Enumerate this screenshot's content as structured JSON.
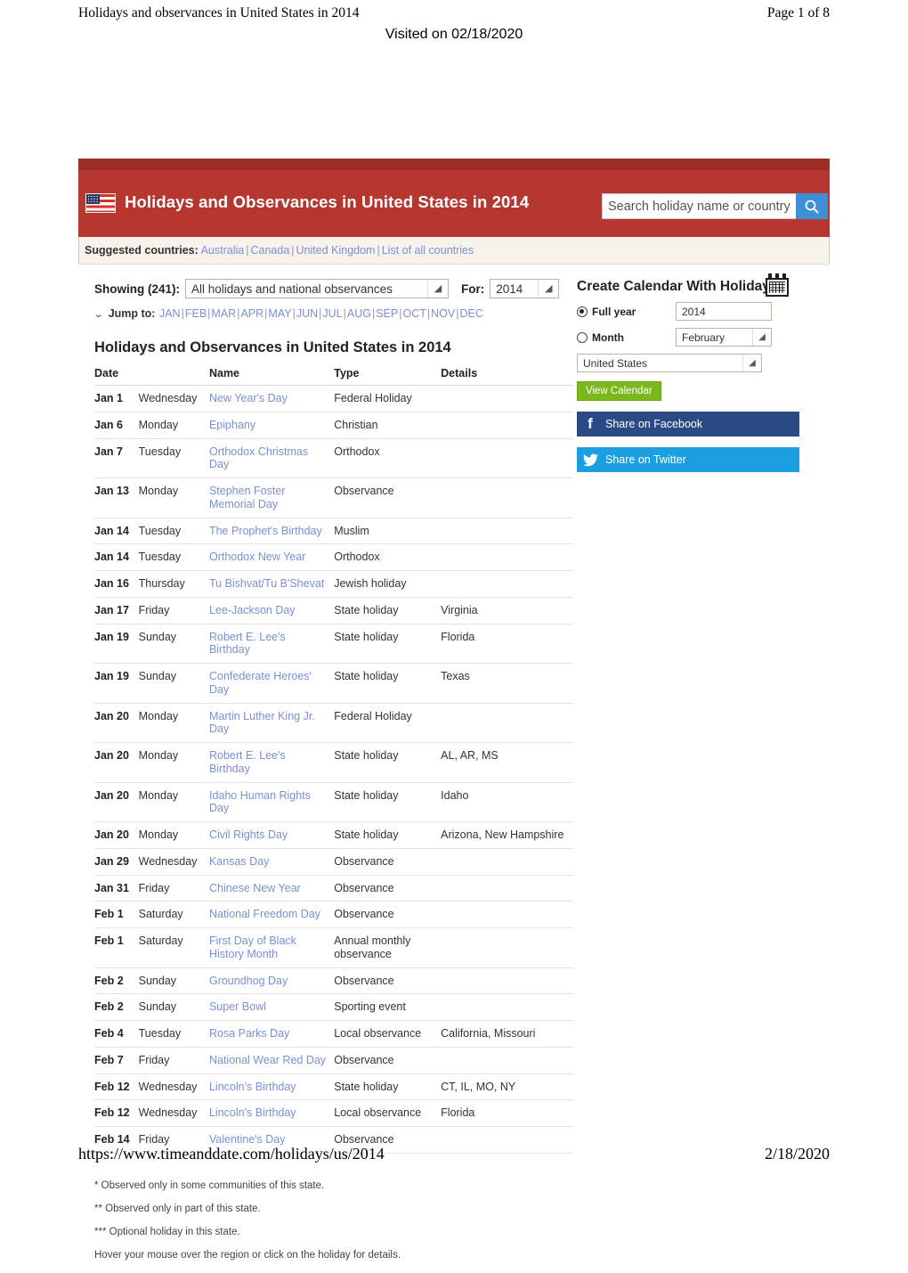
{
  "print": {
    "header_title": "Holidays and observances in United States in 2014",
    "page_indicator": "Page 1 of 8",
    "visited": "Visited on 02/18/2020",
    "footer_url": "https://www.timeanddate.com/holidays/us/2014",
    "footer_date": "2/18/2020"
  },
  "banner": {
    "title": "Holidays and Observances in United States in 2014",
    "flag_icon": "us-flag-icon",
    "search_placeholder": "Search holiday name or country",
    "search_value": "",
    "search_icon": "search-icon",
    "bg_color": "#b5372f"
  },
  "suggested": {
    "label": "Suggested countries:",
    "links": [
      "Australia",
      "Canada",
      "United Kingdom",
      "List of all countries"
    ]
  },
  "filters": {
    "showing_label": "Showing (241):",
    "showing_value": "All holidays and national observances",
    "for_label": "For:",
    "year_value": "2014",
    "jump_label": "Jump to:",
    "jump_months": [
      "JAN",
      "FEB",
      "MAR",
      "APR",
      "MAY",
      "JUN",
      "JUL",
      "AUG",
      "SEP",
      "OCT",
      "NOV",
      "DEC"
    ]
  },
  "main": {
    "section_title": "Holidays and Observances in United States in 2014",
    "columns": [
      "Date",
      "",
      "Name",
      "Type",
      "Details"
    ],
    "rows": [
      {
        "date": "Jan 1",
        "day": "Wednesday",
        "name": "New Year's Day",
        "type": "Federal Holiday",
        "details": ""
      },
      {
        "date": "Jan 6",
        "day": "Monday",
        "name": "Epiphany",
        "type": "Christian",
        "details": ""
      },
      {
        "date": "Jan 7",
        "day": "Tuesday",
        "name": "Orthodox Christmas Day",
        "type": "Orthodox",
        "details": ""
      },
      {
        "date": "Jan 13",
        "day": "Monday",
        "name": "Stephen Foster Memorial Day",
        "type": "Observance",
        "details": ""
      },
      {
        "date": "Jan 14",
        "day": "Tuesday",
        "name": "The Prophet's Birthday",
        "type": "Muslim",
        "details": ""
      },
      {
        "date": "Jan 14",
        "day": "Tuesday",
        "name": "Orthodox New Year",
        "type": "Orthodox",
        "details": ""
      },
      {
        "date": "Jan 16",
        "day": "Thursday",
        "name": "Tu Bishvat/Tu B'Shevat",
        "type": "Jewish holiday",
        "details": ""
      },
      {
        "date": "Jan 17",
        "day": "Friday",
        "name": "Lee-Jackson Day",
        "type": "State holiday",
        "details": "Virginia"
      },
      {
        "date": "Jan 19",
        "day": "Sunday",
        "name": "Robert E. Lee's Birthday",
        "type": "State holiday",
        "details": "Florida"
      },
      {
        "date": "Jan 19",
        "day": "Sunday",
        "name": "Confederate Heroes' Day",
        "type": "State holiday",
        "details": "Texas"
      },
      {
        "date": "Jan 20",
        "day": "Monday",
        "name": "Martin Luther King Jr. Day",
        "type": "Federal Holiday",
        "details": ""
      },
      {
        "date": "Jan 20",
        "day": "Monday",
        "name": "Robert E. Lee's Birthday",
        "type": "State holiday",
        "details": "AL, AR, MS"
      },
      {
        "date": "Jan 20",
        "day": "Monday",
        "name": "Idaho Human Rights Day",
        "type": "State holiday",
        "details": "Idaho"
      },
      {
        "date": "Jan 20",
        "day": "Monday",
        "name": "Civil Rights Day",
        "type": "State holiday",
        "details": "Arizona, New Hampshire"
      },
      {
        "date": "Jan 29",
        "day": "Wednesday",
        "name": "Kansas Day",
        "type": "Observance",
        "details": ""
      },
      {
        "date": "Jan 31",
        "day": "Friday",
        "name": "Chinese New Year",
        "type": "Observance",
        "details": ""
      },
      {
        "date": "Feb 1",
        "day": "Saturday",
        "name": "National Freedom Day",
        "type": "Observance",
        "details": ""
      },
      {
        "date": "Feb 1",
        "day": "Saturday",
        "name": "First Day of Black History Month",
        "type": "Annual monthly observance",
        "details": ""
      },
      {
        "date": "Feb 2",
        "day": "Sunday",
        "name": "Groundhog Day",
        "type": "Observance",
        "details": ""
      },
      {
        "date": "Feb 2",
        "day": "Sunday",
        "name": "Super Bowl",
        "type": "Sporting event",
        "details": ""
      },
      {
        "date": "Feb 4",
        "day": "Tuesday",
        "name": "Rosa Parks Day",
        "type": "Local observance",
        "details": "California, Missouri"
      },
      {
        "date": "Feb 7",
        "day": "Friday",
        "name": "National Wear Red Day",
        "type": "Observance",
        "details": ""
      },
      {
        "date": "Feb 12",
        "day": "Wednesday",
        "name": "Lincoln's Birthday",
        "type": "State holiday",
        "details": "CT, IL, MO, NY"
      },
      {
        "date": "Feb 12",
        "day": "Wednesday",
        "name": "Lincoln's Birthday",
        "type": "Local observance",
        "details": "Florida"
      },
      {
        "date": "Feb 14",
        "day": "Friday",
        "name": "Valentine's Day",
        "type": "Observance",
        "details": ""
      }
    ]
  },
  "footnotes": [
    "* Observed only in some communities of this state.",
    "** Observed only in part of this state.",
    "*** Optional holiday in this state.",
    "Hover your mouse over the region or click on the holiday for details."
  ],
  "sidebar": {
    "title": "Create Calendar With Holidays",
    "calendar_icon": "calendar-icon",
    "full_year_label": "Full year",
    "full_year_selected": true,
    "year_value": "2014",
    "month_label": "Month",
    "month_selected": false,
    "month_value": "February",
    "country_value": "United States",
    "view_calendar_label": "View Calendar",
    "facebook_label": "Share on Facebook",
    "facebook_icon": "facebook-icon",
    "facebook_color": "#2b4a85",
    "twitter_label": "Share on Twitter",
    "twitter_icon": "twitter-icon",
    "twitter_color": "#1b9fe0"
  }
}
